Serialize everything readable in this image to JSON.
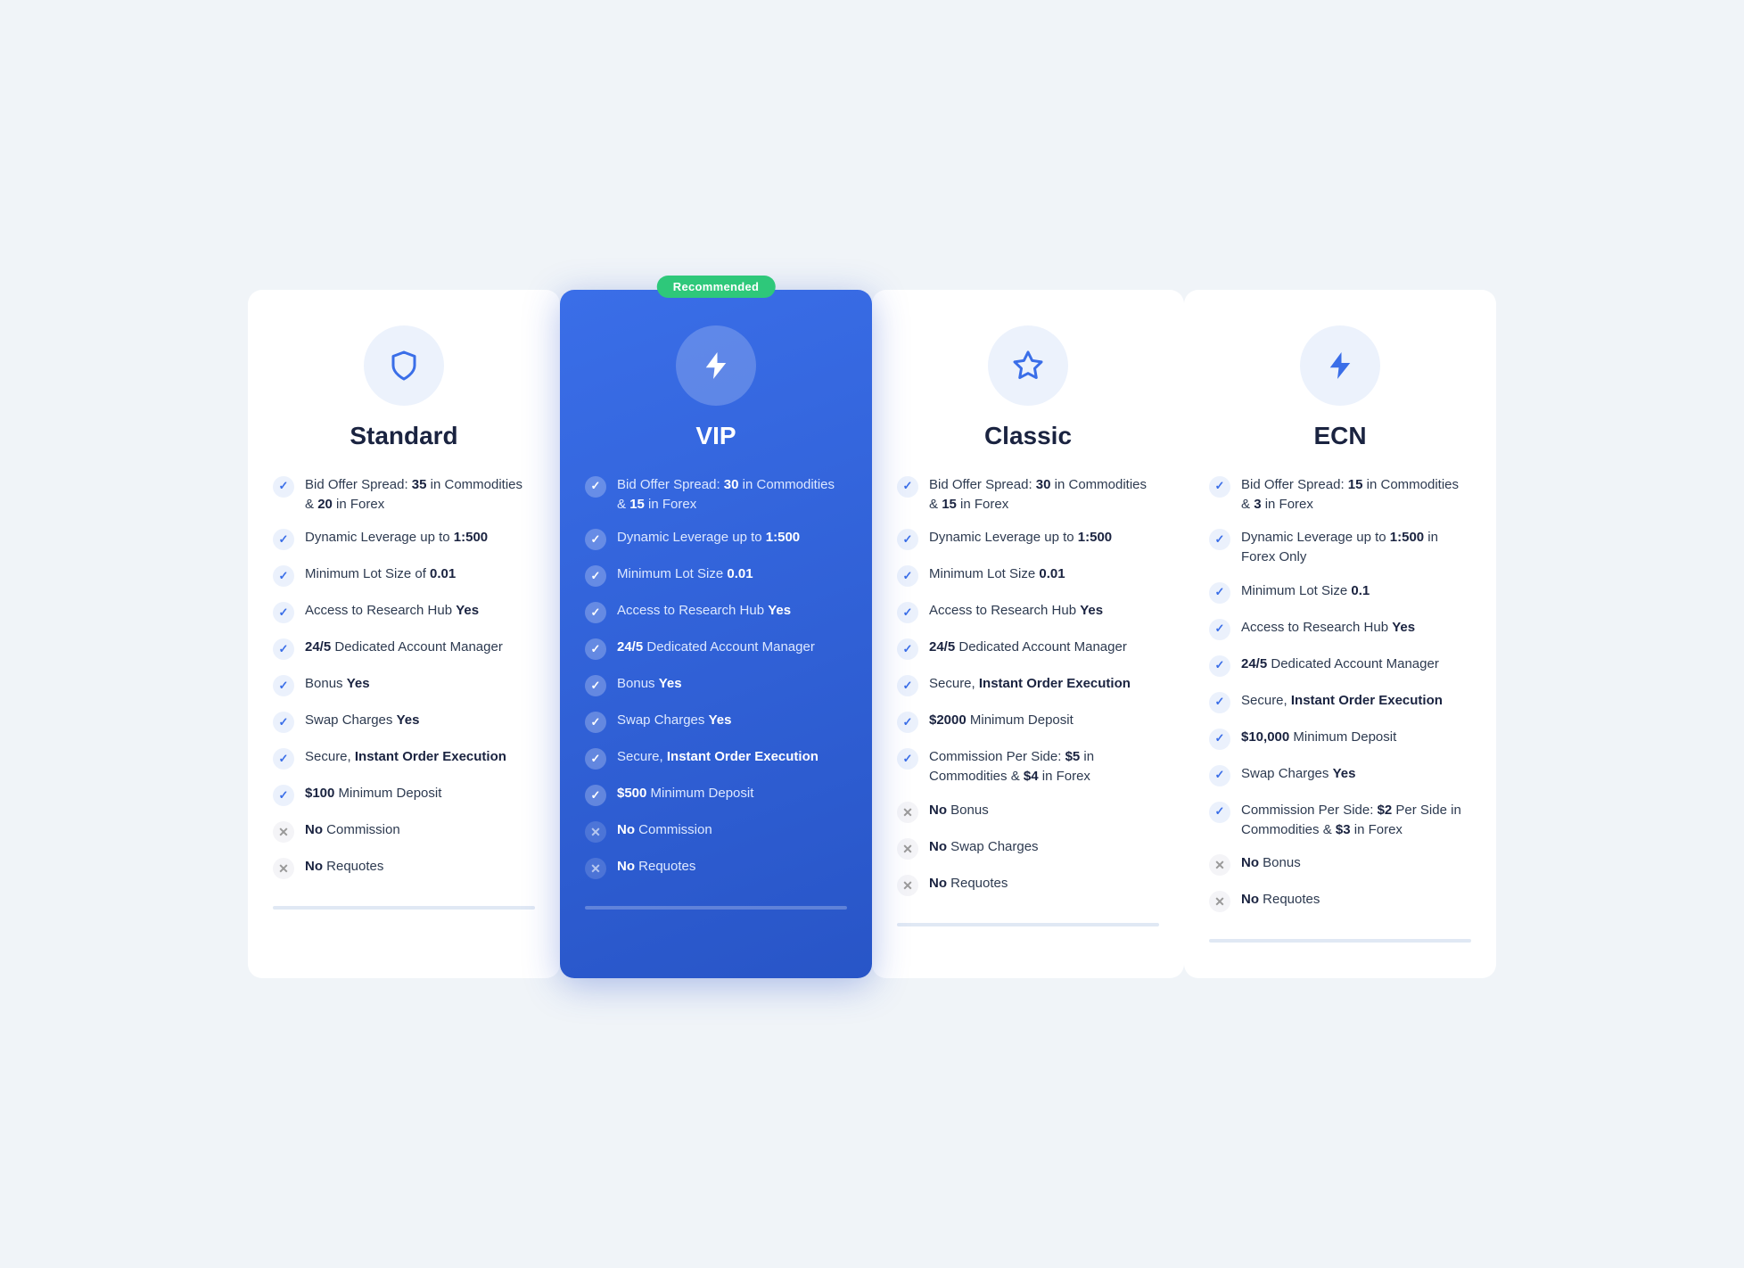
{
  "plans": [
    {
      "id": "standard",
      "title": "Standard",
      "icon": "shield",
      "recommended": false,
      "features": [
        {
          "type": "check",
          "html": "Bid Offer Spread: <b>35</b> in Commodities & <b>20</b> in Forex"
        },
        {
          "type": "check",
          "html": "Dynamic Leverage up to <b>1:500</b>"
        },
        {
          "type": "check",
          "html": "Minimum Lot Size of <b>0.01</b>"
        },
        {
          "type": "check",
          "html": "Access to Research Hub <b>Yes</b>"
        },
        {
          "type": "check",
          "html": "<b>24/5</b> Dedicated Account Manager"
        },
        {
          "type": "check",
          "html": "Bonus <b>Yes</b>"
        },
        {
          "type": "check",
          "html": "Swap Charges <b>Yes</b>"
        },
        {
          "type": "check",
          "html": "Secure, <b>Instant Order Execution</b>"
        },
        {
          "type": "check",
          "html": "<b>$100</b> Minimum Deposit"
        },
        {
          "type": "cross",
          "html": "<b>No</b> Commission"
        },
        {
          "type": "cross",
          "html": "<b>No</b> Requotes"
        }
      ]
    },
    {
      "id": "vip",
      "title": "VIP",
      "icon": "bolt",
      "recommended": true,
      "recommendedLabel": "Recommended",
      "features": [
        {
          "type": "check",
          "html": "Bid Offer Spread: <b>30</b> in Commodities & <b>15</b> in Forex"
        },
        {
          "type": "check",
          "html": "Dynamic Leverage up to <b>1:500</b>"
        },
        {
          "type": "check",
          "html": "Minimum Lot Size <b>0.01</b>"
        },
        {
          "type": "check",
          "html": "Access to Research Hub <b>Yes</b>"
        },
        {
          "type": "check",
          "html": "<b>24/5</b> Dedicated Account Manager"
        },
        {
          "type": "check",
          "html": "Bonus <b>Yes</b>"
        },
        {
          "type": "check",
          "html": "Swap Charges <b>Yes</b>"
        },
        {
          "type": "check",
          "html": "Secure, <b>Instant Order Execution</b>"
        },
        {
          "type": "check",
          "html": "<b>$500</b> Minimum Deposit"
        },
        {
          "type": "cross",
          "html": "<b>No</b> Commission"
        },
        {
          "type": "cross",
          "html": "<b>No</b> Requotes"
        }
      ]
    },
    {
      "id": "classic",
      "title": "Classic",
      "icon": "star",
      "recommended": false,
      "features": [
        {
          "type": "check",
          "html": "Bid Offer Spread: <b>30</b> in Commodities & <b>15</b> in Forex"
        },
        {
          "type": "check",
          "html": "Dynamic Leverage up to <b>1:500</b>"
        },
        {
          "type": "check",
          "html": "Minimum Lot Size <b>0.01</b>"
        },
        {
          "type": "check",
          "html": "Access to Research Hub <b>Yes</b>"
        },
        {
          "type": "check",
          "html": "<b>24/5</b> Dedicated Account Manager"
        },
        {
          "type": "check",
          "html": "Secure, <b>Instant Order Execution</b>"
        },
        {
          "type": "check",
          "html": "<b>$2000</b> Minimum Deposit"
        },
        {
          "type": "check",
          "html": "Commission Per Side: <b>$5</b> in Commodities & <b>$4</b> in Forex"
        },
        {
          "type": "cross",
          "html": "<b>No</b> Bonus"
        },
        {
          "type": "cross",
          "html": "<b>No</b> Swap Charges"
        },
        {
          "type": "cross",
          "html": "<b>No</b> Requotes"
        }
      ]
    },
    {
      "id": "ecn",
      "title": "ECN",
      "icon": "lightning",
      "recommended": false,
      "features": [
        {
          "type": "check",
          "html": "Bid Offer Spread: <b>15</b> in Commodities & <b>3</b> in Forex"
        },
        {
          "type": "check",
          "html": "Dynamic Leverage up to <b>1:500</b> in Forex Only"
        },
        {
          "type": "check",
          "html": "Minimum Lot Size <b>0.1</b>"
        },
        {
          "type": "check",
          "html": "Access to Research Hub <b>Yes</b>"
        },
        {
          "type": "check",
          "html": "<b>24/5</b> Dedicated Account Manager"
        },
        {
          "type": "check",
          "html": "Secure, <b>Instant Order Execution</b>"
        },
        {
          "type": "check",
          "html": "<b>$10,000</b> Minimum Deposit"
        },
        {
          "type": "check",
          "html": "Swap Charges <b>Yes</b>"
        },
        {
          "type": "check",
          "html": "Commission Per Side: <b>$2</b> Per Side in Commodities & <b>$3</b> in Forex"
        },
        {
          "type": "cross",
          "html": "<b>No</b> Bonus"
        },
        {
          "type": "cross",
          "html": "<b>No</b> Requotes"
        }
      ]
    }
  ],
  "icons": {
    "shield": "shield",
    "bolt": "bolt",
    "star": "star",
    "lightning": "lightning"
  }
}
